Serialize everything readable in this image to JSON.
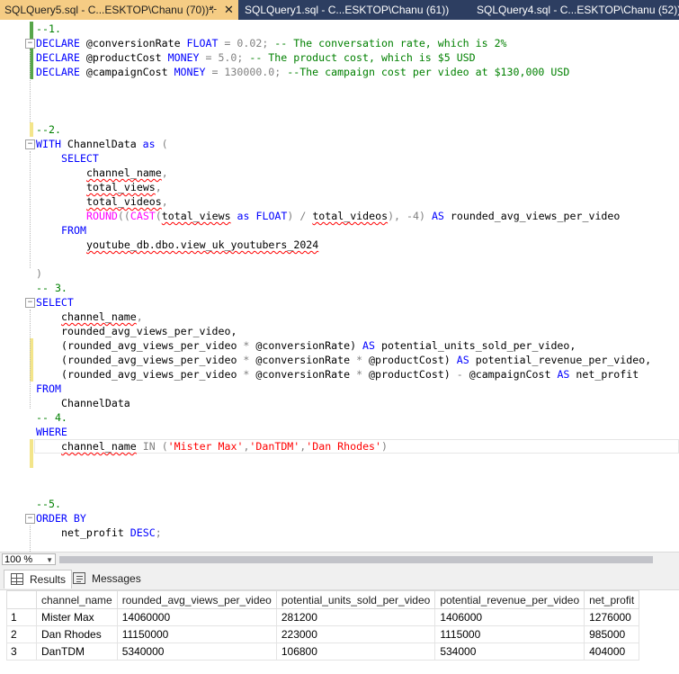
{
  "tabs": [
    {
      "label": "SQLQuery5.sql - C...ESKTOP\\Chanu (70))*",
      "pin": "⊹",
      "close": "✕"
    },
    {
      "label": "SQLQuery1.sql - C...ESKTOP\\Chanu (61))"
    },
    {
      "label": "SQLQuery4.sql - C...ESKTOP\\Chanu (52))"
    }
  ],
  "editor": {
    "comment_1": "--1.",
    "declare_1": [
      "DECLARE",
      " @conversionRate ",
      "FLOAT",
      " = 0.02; ",
      "-- The conversation rate, which is 2%"
    ],
    "declare_2": [
      "DECLARE",
      " @productCost ",
      "MONEY",
      " = 5.0; ",
      "-- The product cost, which is $5 USD"
    ],
    "declare_3": [
      "DECLARE",
      " @campaignCost ",
      "MONEY",
      " = 130000.0; ",
      "--The campaign cost per video at $130,000 USD"
    ],
    "comment_2": "--2.",
    "with_line": [
      "WITH",
      " ChannelData ",
      "as",
      " ("
    ],
    "select_kw": "SELECT",
    "col_channel_name": "channel_name",
    "col_total_views": "total_views",
    "col_total_videos": "total_videos",
    "round_line": [
      "ROUND",
      "((",
      "CAST",
      "(",
      "total_views",
      " as ",
      "FLOAT",
      ") / ",
      "total_videos",
      "), -4) ",
      "AS",
      " rounded_avg_views_per_video"
    ],
    "from_kw": "FROM",
    "table_name": "youtube_db.dbo.view_uk_youtubers_2024",
    "close_paren": ")",
    "comment_3": "-- 3.",
    "select2_kw": "SELECT",
    "sel_channel_name": "channel_name",
    "sel_rounded": "rounded_avg_views_per_video,",
    "sel_units": [
      "(rounded_avg_views_per_video ",
      "*",
      " @conversionRate) ",
      "AS",
      " potential_units_sold_per_video,"
    ],
    "sel_revenue": [
      "(rounded_avg_views_per_video ",
      "*",
      " @conversionRate ",
      "*",
      " @productCost) ",
      "AS",
      " potential_revenue_per_video,"
    ],
    "sel_profit": [
      "(rounded_avg_views_per_video ",
      "*",
      " @conversionRate ",
      "*",
      " @productCost) ",
      "-",
      " @campaignCost ",
      "AS",
      " net_profit"
    ],
    "from2_kw": "FROM",
    "from2_table": "ChannelData",
    "comment_4": "-- 4.",
    "where_kw": "WHERE",
    "where_line": [
      "channel_name",
      " IN ",
      "(",
      "'Mister Max'",
      ",",
      "'DanTDM'",
      ",",
      "'Dan Rhodes'",
      ")"
    ],
    "comment_5": "--5.",
    "order_kw": "ORDER BY",
    "order_line": [
      "net_profit ",
      "DESC",
      ";"
    ]
  },
  "zoom": {
    "value": "100 %"
  },
  "results_tabs": [
    {
      "label": "Results",
      "icon": "grid-icon"
    },
    {
      "label": "Messages",
      "icon": "messages-icon"
    }
  ],
  "results": {
    "columns": [
      "channel_name",
      "rounded_avg_views_per_video",
      "potential_units_sold_per_video",
      "potential_revenue_per_video",
      "net_profit"
    ],
    "rows": [
      {
        "num": "1",
        "cells": [
          "Mister Max",
          "14060000",
          "281200",
          "1406000",
          "1276000"
        ]
      },
      {
        "num": "2",
        "cells": [
          "Dan Rhodes",
          "11150000",
          "223000",
          "1115000",
          "985000"
        ]
      },
      {
        "num": "3",
        "cells": [
          "DanTDM",
          "5340000",
          "106800",
          "534000",
          "404000"
        ]
      }
    ]
  },
  "colors": {
    "tab_strip": "#2d3e61",
    "active_tab": "#f5cc84",
    "keyword": "#0000ff",
    "comment": "#008000",
    "string": "#ff0000",
    "function": "#ff00ff",
    "operator": "#808080"
  }
}
